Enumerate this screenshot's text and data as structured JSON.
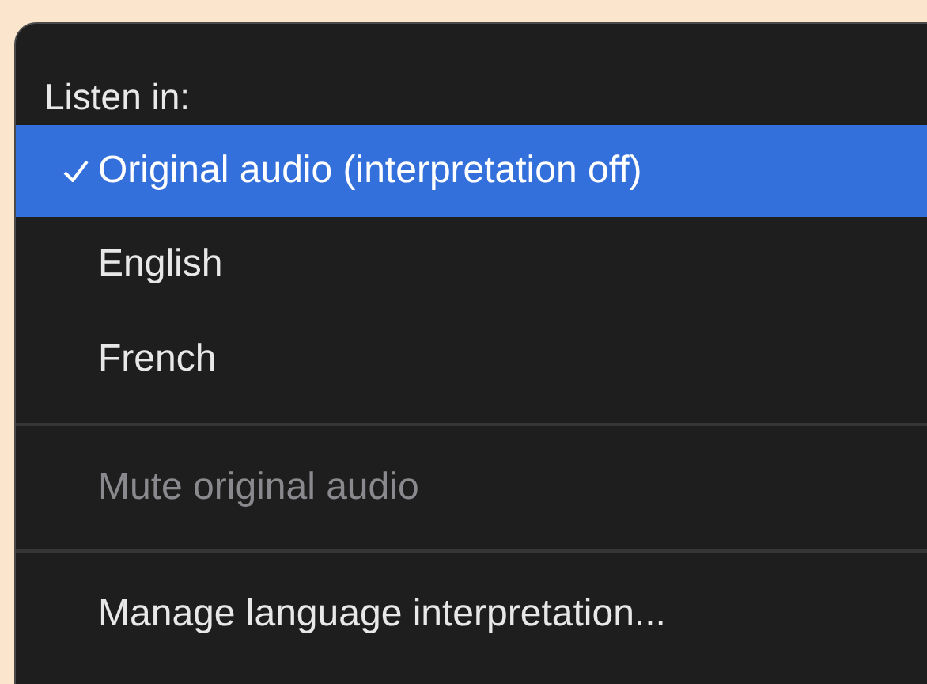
{
  "menu": {
    "header": "Listen in:",
    "items": [
      {
        "kind": "option",
        "label": "Original audio (interpretation off)",
        "selected": true
      },
      {
        "kind": "option",
        "label": "English",
        "selected": false
      },
      {
        "kind": "option",
        "label": "French",
        "selected": false
      },
      {
        "kind": "divider"
      },
      {
        "kind": "action",
        "label": "Mute original audio",
        "disabled": true
      },
      {
        "kind": "divider"
      },
      {
        "kind": "action",
        "label": "Manage language interpretation...",
        "disabled": false
      }
    ]
  }
}
